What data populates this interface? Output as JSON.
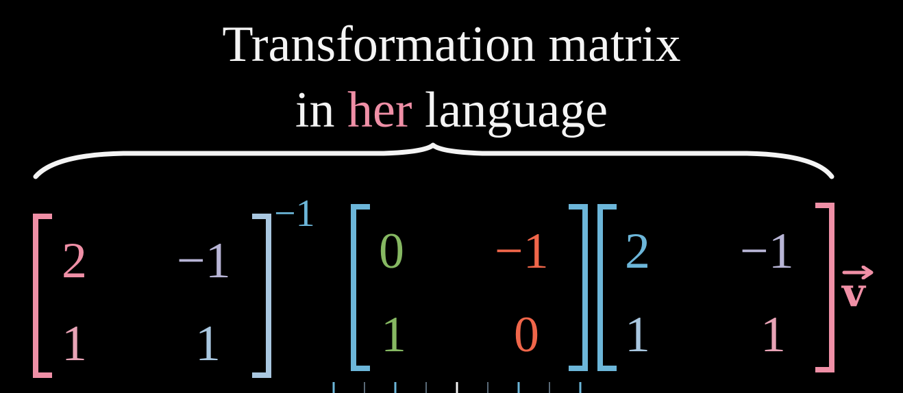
{
  "heading": {
    "line1": "Transformation matrix",
    "line2_pre": "in ",
    "line2_highlight": "her",
    "line2_post": " language"
  },
  "matrix_a": {
    "cells": [
      "2",
      "−1",
      "1",
      "1"
    ]
  },
  "inverse_exponent": "−1",
  "matrix_b": {
    "cells": [
      "0",
      "−1",
      "1",
      "0"
    ]
  },
  "matrix_c": {
    "cells": [
      "2",
      "−1",
      "1",
      "1"
    ]
  },
  "vector": "v",
  "colors": {
    "background": "#000000",
    "text": "#f4f4f4",
    "pink": "#ef8fa6",
    "light_pink": "#e8a3b6",
    "lavender": "#b8b5d6",
    "blue": "#6cb6d9",
    "light_blue": "#a9c7e0",
    "green": "#86b862",
    "red": "#f0664a"
  }
}
